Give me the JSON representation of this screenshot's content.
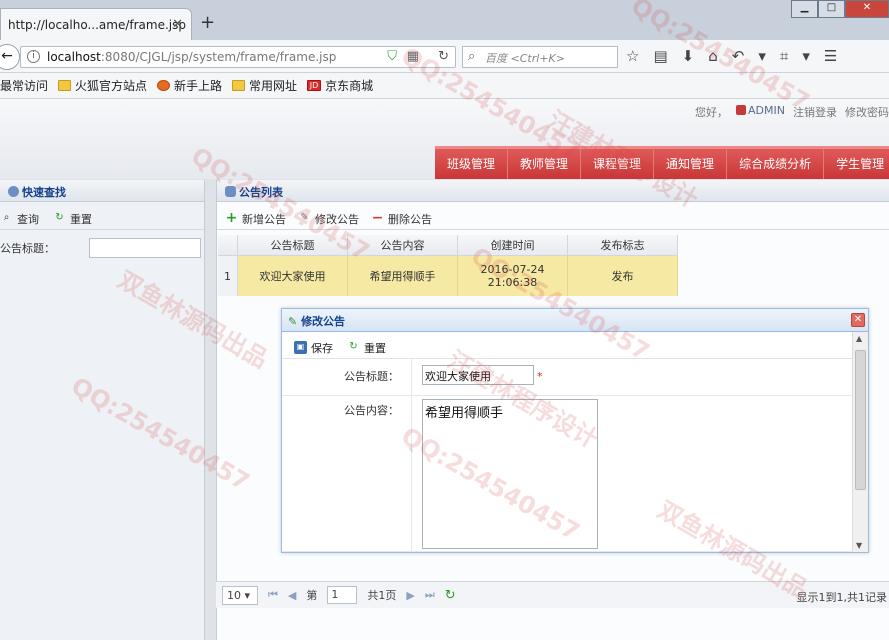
{
  "browser": {
    "tab_title": "http://localho...ame/frame.jsp",
    "url_host": "localhost",
    "url_path": ":8080/CJGL/jsp/system/frame/frame.jsp",
    "search_placeholder": "百度 <Ctrl+K>",
    "bookmarks": [
      "最常访问",
      "火狐官方站点",
      "新手上路",
      "常用网址",
      "京东商城"
    ]
  },
  "header": {
    "greeting": "您好，",
    "username": "ADMIN",
    "logout": "注销登录",
    "change_password": "修改密码",
    "menu": [
      "班级管理",
      "教师管理",
      "课程管理",
      "通知管理",
      "综合成绩分析",
      "学生管理"
    ]
  },
  "left_panel": {
    "title": "快速查找",
    "query_button": "查询",
    "reset_button": "重置",
    "field_label": "公告标题："
  },
  "main_panel": {
    "title": "公告列表",
    "add_button": "新增公告",
    "edit_button": "修改公告",
    "delete_button": "删除公告",
    "columns": [
      "公告标题",
      "公告内容",
      "创建时间",
      "发布标志"
    ],
    "rows": [
      {
        "num": "1",
        "title": "欢迎大家使用",
        "content": "希望用得顺手",
        "created_date": "2016-07-24",
        "created_time": "21:06:38",
        "status": "发布"
      }
    ],
    "pager": {
      "page_size": "10",
      "page_prefix": "第",
      "page_value": "1",
      "page_suffix": "共1页",
      "info": "显示1到1,共1记录"
    }
  },
  "dialog": {
    "title": "修改公告",
    "save_button": "保存",
    "reset_button": "重置",
    "title_label": "公告标题：",
    "title_value": "欢迎大家使用",
    "required_mark": "*",
    "content_label": "公告内容：",
    "content_value": "希望用得顺手"
  },
  "watermark": {
    "qq": "QQ:254540457",
    "a": "双鱼林源码出品",
    "b": "汪建林程序设计"
  }
}
